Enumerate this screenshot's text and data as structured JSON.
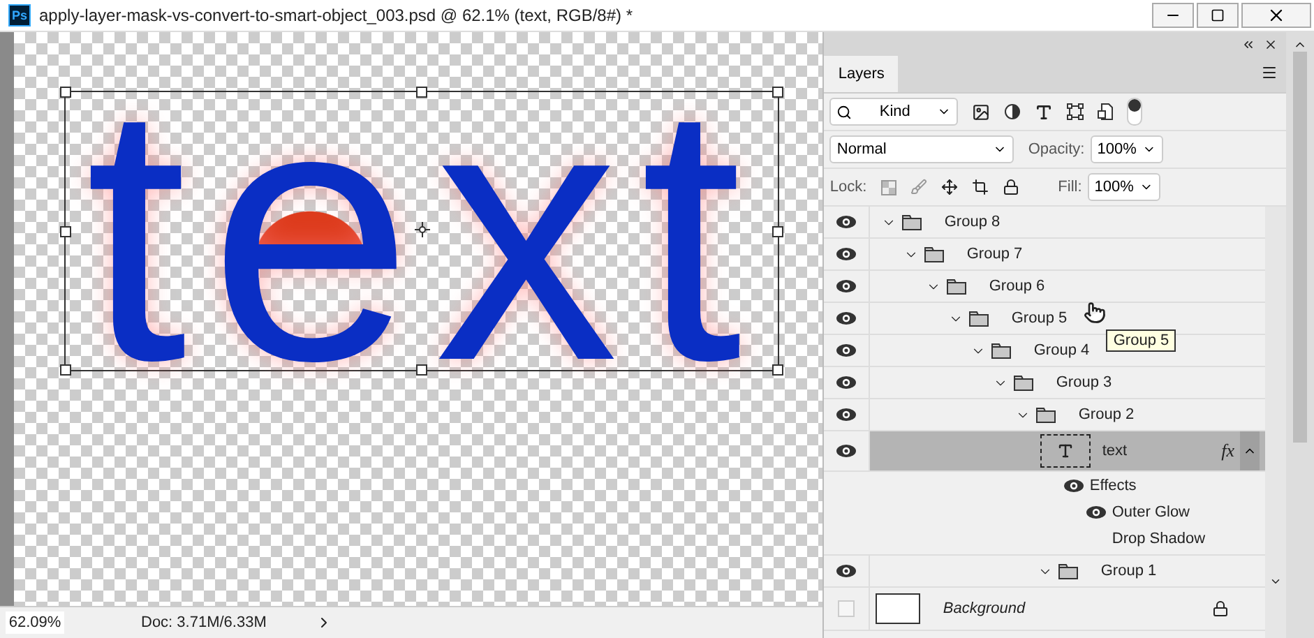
{
  "window": {
    "app_icon": "Ps",
    "title": "apply-layer-mask-vs-convert-to-smart-object_003.psd @ 62.1% (text, RGB/8#) *"
  },
  "canvas": {
    "text": "text"
  },
  "status_bar": {
    "zoom": "62.09%",
    "doc": "Doc: 3.71M/6.33M"
  },
  "panel": {
    "tabs": [
      {
        "label": "Layers",
        "selected": true
      }
    ],
    "filter": {
      "value": "Kind",
      "toggle_on": true
    },
    "blend_mode": {
      "value": "Normal"
    },
    "opacity": {
      "label": "Opacity:",
      "value": "100%"
    },
    "lock_label": "Lock:",
    "fill": {
      "label": "Fill:",
      "value": "100%"
    },
    "tooltip": "Group 5",
    "layers": [
      {
        "name": "Group 8",
        "kind": "group",
        "visible": true,
        "expanded": true,
        "selected": false,
        "children": [
          {
            "name": "Group 7",
            "kind": "group",
            "visible": true,
            "expanded": true,
            "selected": false,
            "children": [
              {
                "name": "Group 6",
                "kind": "group",
                "visible": true,
                "expanded": true,
                "selected": false,
                "children": [
                  {
                    "name": "Group 5",
                    "kind": "group",
                    "visible": true,
                    "expanded": true,
                    "selected": false,
                    "tooltip": true,
                    "children": [
                      {
                        "name": "Group 4",
                        "kind": "group",
                        "visible": true,
                        "expanded": true,
                        "selected": false,
                        "children": [
                          {
                            "name": "Group 3",
                            "kind": "group",
                            "visible": true,
                            "expanded": true,
                            "selected": false,
                            "children": [
                              {
                                "name": "Group 2",
                                "kind": "group",
                                "visible": true,
                                "expanded": true,
                                "selected": false,
                                "children": [
                                  {
                                    "name": "text",
                                    "kind": "text",
                                    "visible": true,
                                    "selected": true,
                                    "fx": "fx",
                                    "effects_expanded": true,
                                    "effects_label": "Effects",
                                    "effects_visible": true,
                                    "effects": [
                                      {
                                        "name": "Outer Glow",
                                        "visible": true
                                      },
                                      {
                                        "name": "Drop Shadow",
                                        "visible": false
                                      }
                                    ]
                                  },
                                  {
                                    "name": "Group 1",
                                    "kind": "group",
                                    "visible": true,
                                    "expanded": true,
                                    "selected": false
                                  }
                                ]
                              }
                            ]
                          }
                        ]
                      }
                    ]
                  }
                ]
              }
            ]
          }
        ]
      },
      {
        "name": "Background",
        "kind": "background",
        "visible": false,
        "locked": true,
        "selected": false
      }
    ]
  }
}
